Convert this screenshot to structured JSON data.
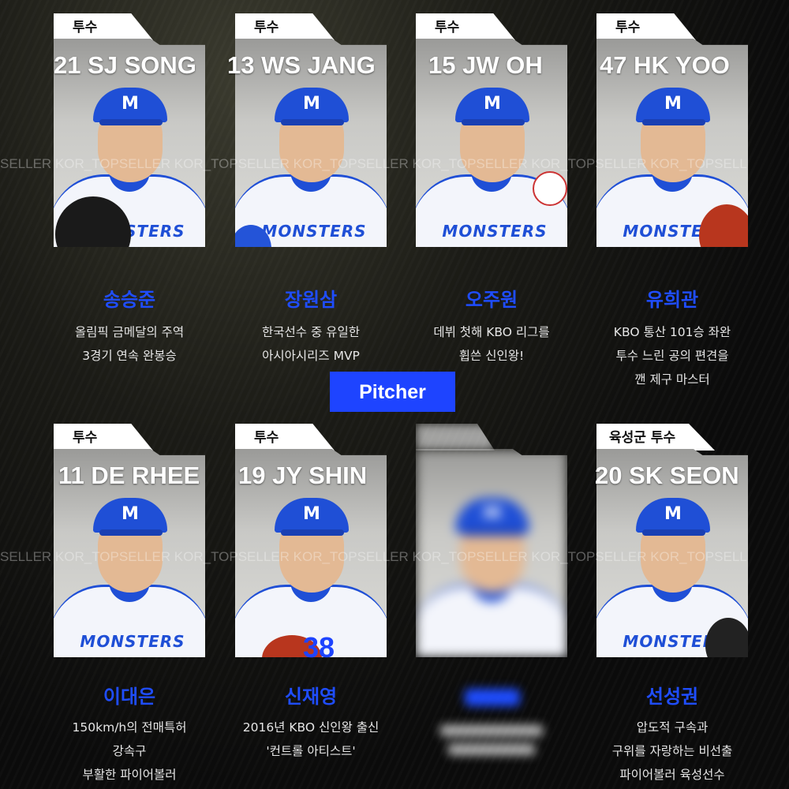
{
  "top_row": [
    {
      "position": "투수",
      "overlay_name": "21 SJ SONG",
      "korean_name": "송승준",
      "description": [
        "올림픽 금메달의 주역",
        "3경기 연속 완봉승"
      ]
    },
    {
      "position": "투수",
      "overlay_name": "13 WS JANG",
      "korean_name": "장원삼",
      "description": [
        "한국선수 중 유일한",
        "아시아시리즈 MVP"
      ]
    },
    {
      "position": "투수",
      "overlay_name": "15 JW OH",
      "korean_name": "오주원",
      "description": [
        "데뷔 첫해 KBO 리그를",
        "휩쓴 신인왕!"
      ]
    },
    {
      "position": "투수",
      "overlay_name": "47 HK YOO",
      "korean_name": "유희관",
      "description": [
        "KBO 통산 101승 좌완",
        "투수 느린 공의 편견을",
        "깬 제구 마스터"
      ]
    }
  ],
  "section_button": "Pitcher",
  "bottom_row": [
    {
      "position": "투수",
      "overlay_name": "11 DE RHEE",
      "korean_name": "이대은",
      "description": [
        "150km/h의 전매특허",
        "강속구",
        "부활한 파이어볼러"
      ]
    },
    {
      "position": "투수",
      "overlay_name": "19 JY SHIN",
      "korean_name": "신재영",
      "description": [
        "2016년 KBO 신인왕 출신",
        "'컨트롤 아티스트'"
      ]
    },
    {
      "position": "",
      "overlay_name": "",
      "korean_name": "",
      "description": []
    },
    {
      "position": "육성군 투수",
      "overlay_name": "20 SK SEON",
      "korean_name": "선성권",
      "description": [
        "압도적 구속과",
        "구위를 자랑하는 비선출",
        "파이어볼러 육성선수"
      ]
    }
  ],
  "jersey_number": "38",
  "jersey_text": "MONSTERS",
  "cap_letter": "M",
  "watermark": "SELLER KOR_TOPSELLER KOR_TOPSELLER KOR_TOPSELLER KOR_TOPSELLER KOR_TOPSELLER KOR_TOPSELL",
  "colors": {
    "accent": "#1e44ff",
    "name_blue": "#1f4dff",
    "background": "#0d0d0d"
  }
}
